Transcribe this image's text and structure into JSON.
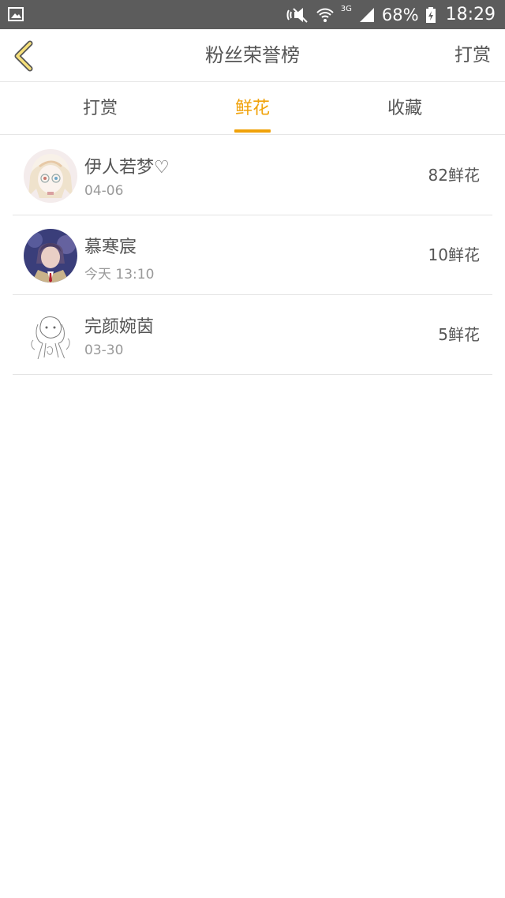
{
  "status_bar": {
    "left_icon": "image-icon",
    "battery": "68%",
    "time": "18:29",
    "network_label": "3G"
  },
  "header": {
    "title": "粉丝荣誉榜",
    "action_label": "打赏",
    "back_icon": "chevron-left-icon",
    "accent_color": "#f0a20a"
  },
  "tabs": [
    {
      "label": "打赏",
      "active": false
    },
    {
      "label": "鲜花",
      "active": true
    },
    {
      "label": "收藏",
      "active": false
    }
  ],
  "fans": [
    {
      "name": "伊人若梦♡",
      "date": "04-06",
      "count": "82鲜花"
    },
    {
      "name": "慕寒宸",
      "date": "今天 13:10",
      "count": "10鲜花"
    },
    {
      "name": "完颜婉茵",
      "date": "03-30",
      "count": "5鲜花"
    }
  ]
}
